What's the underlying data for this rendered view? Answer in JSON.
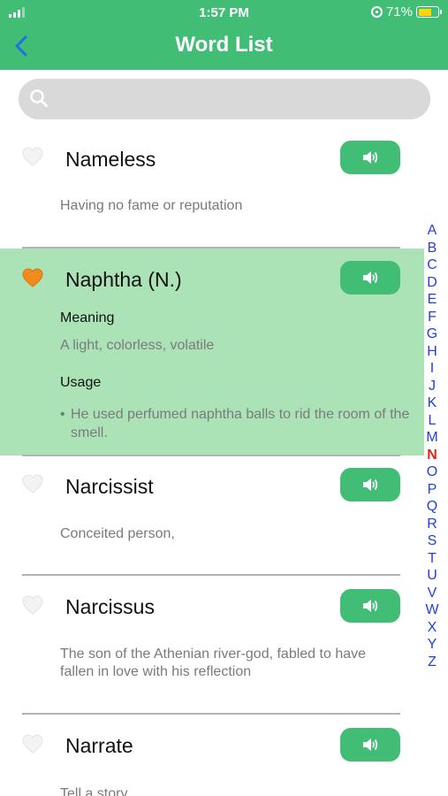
{
  "status_bar": {
    "time": "1:57 PM",
    "battery_percent": "71%"
  },
  "header": {
    "title": "Word List"
  },
  "search": {
    "placeholder": ""
  },
  "words": [
    {
      "word": "Nameless",
      "definition": "Having no fame or reputation",
      "favorite": false
    },
    {
      "word": "Naphtha (N.)",
      "favorite": true,
      "expanded": true,
      "meaning_label": "Meaning",
      "meaning": "A light, colorless, volatile",
      "usage_label": "Usage",
      "usage": "He used perfumed naphtha balls to rid the room of the smell."
    },
    {
      "word": "Narcissist",
      "definition": "Conceited person,",
      "favorite": false
    },
    {
      "word": "Narcissus",
      "definition": "The son of the Athenian river-god, fabled to have fallen in love with his reflection",
      "favorite": false
    },
    {
      "word": "Narrate",
      "definition": "Tell a story",
      "favorite": false
    }
  ],
  "alphabet": [
    "A",
    "B",
    "C",
    "D",
    "E",
    "F",
    "G",
    "H",
    "I",
    "J",
    "K",
    "L",
    "M",
    "N",
    "O",
    "P",
    "Q",
    "R",
    "S",
    "T",
    "U",
    "V",
    "W",
    "X",
    "Y",
    "Z"
  ],
  "alphabet_active": "N",
  "colors": {
    "accent": "#42bd75",
    "expanded_bg": "#abe3b7",
    "index_letter": "#2340d6",
    "index_active": "#e0241b",
    "favorite": "#f28a1c"
  },
  "icons": {
    "back": "chevron-left-icon",
    "search": "search-icon",
    "heart": "heart-icon",
    "speaker": "speaker-icon"
  }
}
